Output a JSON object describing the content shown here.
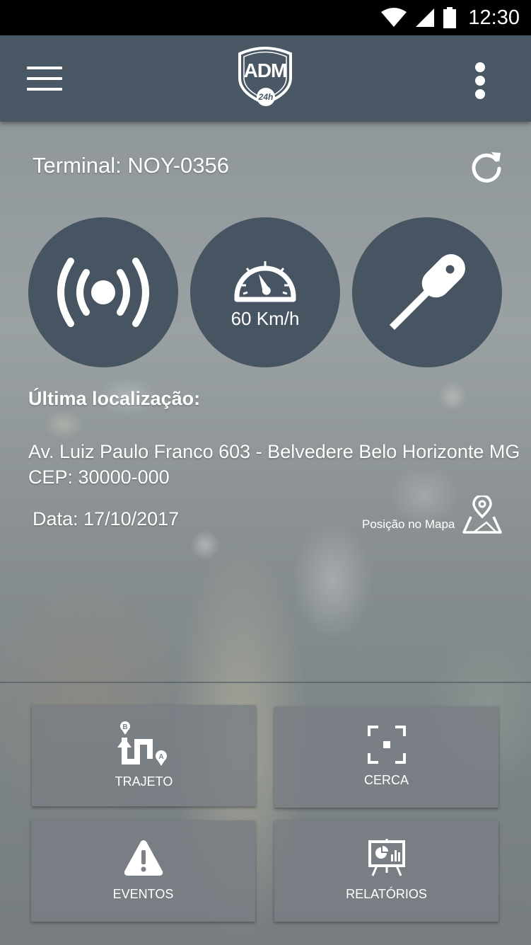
{
  "status_bar": {
    "time": "12:30",
    "icons": [
      "wifi-icon",
      "signal-icon",
      "battery-icon"
    ]
  },
  "app_bar": {
    "menu_icon": "hamburger-menu-icon",
    "logo_text": "ADM",
    "logo_badge": "24h",
    "overflow_icon": "more-vertical-icon"
  },
  "terminal": {
    "label": "Terminal: NOY-0356",
    "refresh_icon": "refresh-icon"
  },
  "status_circles": {
    "signal_icon": "broadcast-signal-icon",
    "speed": "60 Km/h",
    "speedometer_icon": "speedometer-icon",
    "ignition_icon": "key-icon"
  },
  "location": {
    "title": "Última localização:",
    "address_line1": "Av. Luiz Paulo Franco 603 - Belvedere Belo Horizonte MG",
    "address_line2": "CEP: 30000-000",
    "date": "Data: 17/10/2017",
    "map_link": "Posição no Mapa"
  },
  "tiles": [
    {
      "label": "TRAJETO",
      "icon": "route-icon"
    },
    {
      "label": "CERCA",
      "icon": "fence-icon"
    },
    {
      "label": "EVENTOS",
      "icon": "warning-icon"
    },
    {
      "label": "RELATÓRIOS",
      "icon": "report-icon"
    }
  ],
  "colors": {
    "app_bar": "#4a5764",
    "circle": "#475462",
    "status_bar": "#000000"
  }
}
